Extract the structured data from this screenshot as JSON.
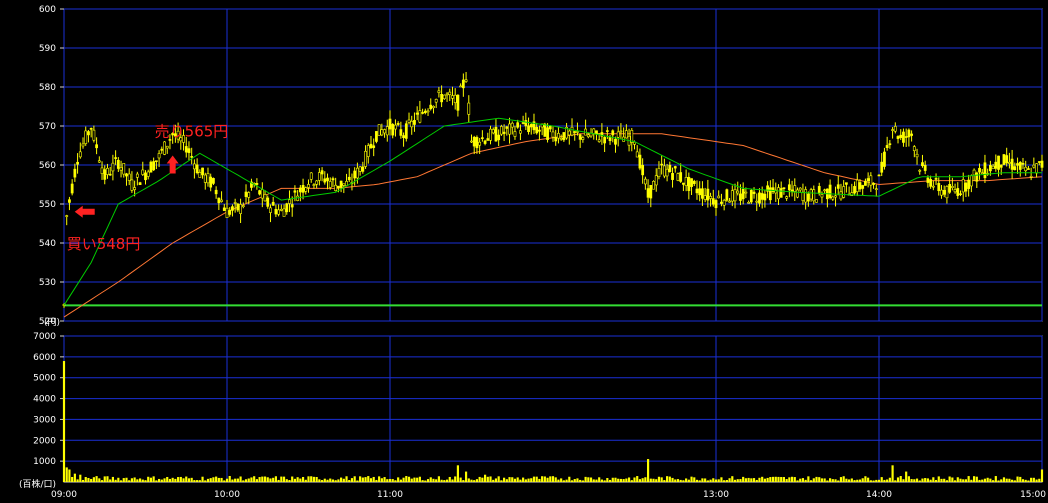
{
  "chart_data": [
    {
      "type": "candlestick",
      "title": "",
      "unit_label": "(円)",
      "ylim": [
        520,
        600
      ],
      "y_ticks": [
        600,
        590,
        580,
        570,
        560,
        550,
        540,
        530,
        520
      ],
      "x_ticks": [
        "09:00",
        "10:00",
        "11:00",
        "13:00",
        "14:00",
        "15:00"
      ],
      "reference_line": 524,
      "price_points": [
        [
          "09:00",
          524
        ],
        [
          "09:01",
          547
        ],
        [
          "09:05",
          562
        ],
        [
          "09:10",
          570
        ],
        [
          "09:15",
          557
        ],
        [
          "09:20",
          561
        ],
        [
          "09:25",
          555
        ],
        [
          "09:30",
          558
        ],
        [
          "09:35",
          562
        ],
        [
          "09:40",
          568
        ],
        [
          "09:45",
          565
        ],
        [
          "09:50",
          558
        ],
        [
          "09:55",
          555
        ],
        [
          "10:00",
          548
        ],
        [
          "10:05",
          549
        ],
        [
          "10:10",
          555
        ],
        [
          "10:15",
          550
        ],
        [
          "10:20",
          548
        ],
        [
          "10:25",
          552
        ],
        [
          "10:30",
          556
        ],
        [
          "10:35",
          557
        ],
        [
          "10:40",
          555
        ],
        [
          "10:45",
          555
        ],
        [
          "10:50",
          560
        ],
        [
          "10:55",
          568
        ],
        [
          "11:00",
          570
        ],
        [
          "11:05",
          568
        ],
        [
          "11:10",
          572
        ],
        [
          "11:15",
          576
        ],
        [
          "11:20",
          578
        ],
        [
          "11:25",
          576
        ],
        [
          "11:28",
          583
        ],
        [
          "11:30",
          566
        ],
        [
          "11:35",
          567
        ],
        [
          "11:40",
          568
        ],
        [
          "11:45",
          569
        ],
        [
          "11:50",
          570
        ],
        [
          "11:55",
          569
        ],
        [
          "12:00",
          568
        ],
        [
          "12:30",
          567
        ],
        [
          "12:35",
          552
        ],
        [
          "12:40",
          559
        ],
        [
          "12:45",
          558
        ],
        [
          "12:50",
          555
        ],
        [
          "12:55",
          553
        ],
        [
          "13:00",
          551
        ],
        [
          "13:05",
          552
        ],
        [
          "13:10",
          552
        ],
        [
          "13:15",
          552
        ],
        [
          "13:20",
          553
        ],
        [
          "13:25",
          553
        ],
        [
          "13:30",
          553
        ],
        [
          "13:35",
          552
        ],
        [
          "13:40",
          553
        ],
        [
          "13:45",
          553
        ],
        [
          "13:50",
          554
        ],
        [
          "13:55",
          555
        ],
        [
          "14:00",
          556
        ],
        [
          "14:05",
          570
        ],
        [
          "14:08",
          567
        ],
        [
          "14:12",
          568
        ],
        [
          "14:15",
          560
        ],
        [
          "14:20",
          555
        ],
        [
          "14:25",
          553
        ],
        [
          "14:30",
          554
        ],
        [
          "14:35",
          557
        ],
        [
          "14:40",
          559
        ],
        [
          "14:45",
          561
        ],
        [
          "14:50",
          560
        ],
        [
          "14:55",
          558
        ],
        [
          "15:00",
          560
        ]
      ],
      "ma_short": [
        [
          "09:00",
          524
        ],
        [
          "09:10",
          535
        ],
        [
          "09:20",
          550
        ],
        [
          "09:35",
          556
        ],
        [
          "09:50",
          563
        ],
        [
          "10:05",
          557
        ],
        [
          "10:20",
          551
        ],
        [
          "10:40",
          553
        ],
        [
          "11:00",
          561
        ],
        [
          "11:20",
          570
        ],
        [
          "11:40",
          572
        ],
        [
          "12:00",
          570
        ],
        [
          "12:30",
          566
        ],
        [
          "12:50",
          559
        ],
        [
          "13:10",
          554
        ],
        [
          "13:30",
          553
        ],
        [
          "14:00",
          552
        ],
        [
          "14:15",
          557
        ],
        [
          "14:30",
          557
        ],
        [
          "14:45",
          558
        ],
        [
          "15:00",
          558
        ]
      ],
      "ma_long": [
        [
          "09:00",
          521
        ],
        [
          "09:20",
          530
        ],
        [
          "09:40",
          540
        ],
        [
          "10:00",
          548
        ],
        [
          "10:20",
          554
        ],
        [
          "10:40",
          554
        ],
        [
          "10:55",
          555
        ],
        [
          "11:10",
          557
        ],
        [
          "11:30",
          563
        ],
        [
          "11:50",
          566
        ],
        [
          "12:10",
          568
        ],
        [
          "12:40",
          568
        ],
        [
          "13:10",
          565
        ],
        [
          "13:40",
          558
        ],
        [
          "14:00",
          555
        ],
        [
          "14:20",
          556
        ],
        [
          "14:40",
          556
        ],
        [
          "15:00",
          557
        ]
      ],
      "annotations": [
        {
          "text": "買い548円",
          "time": "09:01",
          "price": 548,
          "direction": "left"
        },
        {
          "text": "売り565円",
          "time": "09:40",
          "price": 565,
          "direction": "up"
        }
      ],
      "colors": {
        "candle": "#ffff00",
        "ma_short": "#00cc00",
        "ma_long": "#ff7733",
        "reference": "#33dd33",
        "grid": "#1a2fd6",
        "annotation": "#ff2222"
      }
    },
    {
      "type": "bar",
      "unit_label": "(百株/口)",
      "ylim": [
        0,
        7000
      ],
      "y_ticks": [
        7000,
        6000,
        5000,
        4000,
        3000,
        2000,
        1000
      ],
      "volume_points": [
        [
          "09:00",
          5800
        ],
        [
          "09:01",
          700
        ],
        [
          "09:02",
          600
        ],
        [
          "09:04",
          400
        ],
        [
          "09:06",
          350
        ],
        [
          "11:25",
          800
        ],
        [
          "11:28",
          500
        ],
        [
          "11:35",
          350
        ],
        [
          "12:35",
          1100
        ],
        [
          "14:05",
          800
        ],
        [
          "14:10",
          500
        ],
        [
          "15:00",
          600
        ]
      ],
      "baseline_volume": 180,
      "colors": {
        "bar": "#ffff00",
        "grid": "#1a2fd6"
      }
    }
  ]
}
